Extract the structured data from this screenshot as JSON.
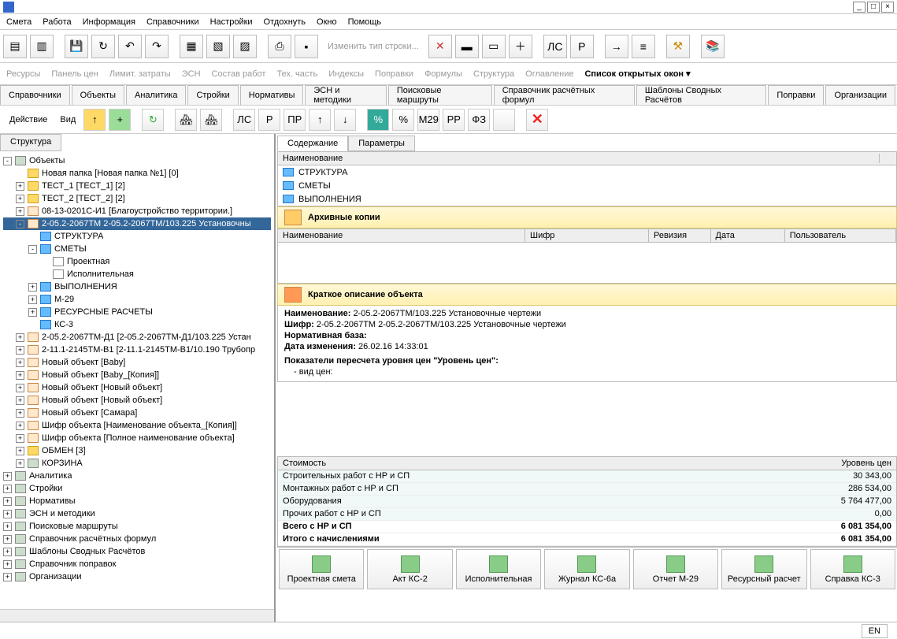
{
  "menubar": [
    "Смета",
    "Работа",
    "Информация",
    "Справочники",
    "Настройки",
    "Отдохнуть",
    "Окно",
    "Помощь"
  ],
  "toolbar1_text": "Изменить тип строки...",
  "toolbar1_badges": [
    "ЛС",
    "Р"
  ],
  "toolbar2": {
    "items": [
      "Ресурсы",
      "Панель цен",
      "Лимит. затраты",
      "ЭСН",
      "Состав работ",
      "Тех. часть",
      "Индексы",
      "Поправки",
      "Формулы",
      "Структура",
      "Оглавление"
    ],
    "active": "Список открытых окон ▾"
  },
  "toolbar3": [
    "Справочники",
    "Объекты",
    "Аналитика",
    "Стройки",
    "Нормативы",
    "ЭСН и методики",
    "Поисковые маршруты",
    "Справочник расчётных формул",
    "Шаблоны Сводных Расчётов",
    "Поправки",
    "Организации"
  ],
  "toolbar4": {
    "action": "Действие",
    "view": "Вид",
    "badges": [
      "ЛС",
      "Р",
      "ПР",
      "%",
      "%",
      "М29",
      "РР",
      "ФЗ"
    ]
  },
  "left_tab": "Структура",
  "tree": [
    {
      "d": 0,
      "e": "-",
      "i": "gen",
      "t": "Объекты"
    },
    {
      "d": 1,
      "e": " ",
      "i": "folder",
      "t": "Новая папка [Новая папка №1]  [0]"
    },
    {
      "d": 1,
      "e": "+",
      "i": "folder",
      "t": "ТЕСТ_1 [ТЕСТ_1]  [2]"
    },
    {
      "d": 1,
      "e": "+",
      "i": "folder",
      "t": "ТЕСТ_2 [ТЕСТ_2]  [2]"
    },
    {
      "d": 1,
      "e": "+",
      "i": "house",
      "t": "08-13-0201С-И1 [Благоустройство территории.]"
    },
    {
      "d": 1,
      "e": "-",
      "i": "house",
      "t": "2-05.2-2067ТМ 2-05.2-2067ТМ/103.225 Установочны",
      "sel": true
    },
    {
      "d": 2,
      "e": " ",
      "i": "bfolder",
      "t": "СТРУКТУРА"
    },
    {
      "d": 2,
      "e": "-",
      "i": "bfolder",
      "t": "СМЕТЫ"
    },
    {
      "d": 3,
      "e": " ",
      "i": "doc",
      "t": "Проектная"
    },
    {
      "d": 3,
      "e": " ",
      "i": "doc",
      "t": "Исполнительная"
    },
    {
      "d": 2,
      "e": "+",
      "i": "bfolder",
      "t": "ВЫПОЛНЕНИЯ"
    },
    {
      "d": 2,
      "e": "+",
      "i": "bfolder",
      "t": "М-29"
    },
    {
      "d": 2,
      "e": "+",
      "i": "bfolder",
      "t": "РЕСУРСНЫЕ РАСЧЕТЫ"
    },
    {
      "d": 2,
      "e": " ",
      "i": "bfolder",
      "t": "КС-3"
    },
    {
      "d": 1,
      "e": "+",
      "i": "house",
      "t": "2-05.2-2067ТМ-Д1 [2-05.2-2067ТМ-Д1/103.225 Устан"
    },
    {
      "d": 1,
      "e": "+",
      "i": "house",
      "t": "2-11.1-2145ТМ-В1 [2-11.1-2145ТМ-В1/10.190 Трубопр"
    },
    {
      "d": 1,
      "e": "+",
      "i": "house",
      "t": "Новый объект [Baby]"
    },
    {
      "d": 1,
      "e": "+",
      "i": "house",
      "t": "Новый объект [Baby_[Копия]]"
    },
    {
      "d": 1,
      "e": "+",
      "i": "house",
      "t": "Новый объект [Новый объект]"
    },
    {
      "d": 1,
      "e": "+",
      "i": "house",
      "t": "Новый объект [Новый объект]"
    },
    {
      "d": 1,
      "e": "+",
      "i": "house",
      "t": "Новый объект [Самара]"
    },
    {
      "d": 1,
      "e": "+",
      "i": "house",
      "t": "Шифр объекта [Наименование объекта_[Копия]]"
    },
    {
      "d": 1,
      "e": "+",
      "i": "house",
      "t": "Шифр объекта [Полное наименование объекта]"
    },
    {
      "d": 1,
      "e": "+",
      "i": "folder",
      "t": "ОБМЕН  [3]"
    },
    {
      "d": 1,
      "e": "+",
      "i": "gen",
      "t": "КОРЗИНА"
    },
    {
      "d": 0,
      "e": "+",
      "i": "gen",
      "t": "Аналитика"
    },
    {
      "d": 0,
      "e": "+",
      "i": "gen",
      "t": "Стройки"
    },
    {
      "d": 0,
      "e": "+",
      "i": "gen",
      "t": "Нормативы"
    },
    {
      "d": 0,
      "e": "+",
      "i": "gen",
      "t": "ЭСН и методики"
    },
    {
      "d": 0,
      "e": "+",
      "i": "gen",
      "t": "Поисковые маршруты"
    },
    {
      "d": 0,
      "e": "+",
      "i": "gen",
      "t": "Справочник расчётных формул"
    },
    {
      "d": 0,
      "e": "+",
      "i": "gen",
      "t": "Шаблоны Сводных Расчётов"
    },
    {
      "d": 0,
      "e": "+",
      "i": "gen",
      "t": "Справочник поправок"
    },
    {
      "d": 0,
      "e": "+",
      "i": "gen",
      "t": "Организации"
    }
  ],
  "right_tabs": [
    "Содержание",
    "Параметры"
  ],
  "content_header": "Наименование",
  "content_rows": [
    "СТРУКТУРА",
    "СМЕТЫ",
    "ВЫПОЛНЕНИЯ"
  ],
  "archive": {
    "banner": "Архивные копии",
    "cols": [
      "Наименование",
      "Шифр",
      "Ревизия",
      "Дата",
      "Пользователь"
    ]
  },
  "desc": {
    "banner": "Краткое описание объекта",
    "name_lbl": "Наименование:",
    "name_val": "2-05.2-2067ТМ/103.225 Установочные чертежи",
    "code_lbl": "Шифр:",
    "code_val": "2-05.2-2067ТМ 2-05.2-2067ТМ/103.225 Установочные чертежи",
    "base_lbl": "Нормативная база:",
    "base_val": "",
    "date_lbl": "Дата изменения:",
    "date_val": "26.02.16 14:33:01",
    "recalc": "Показатели пересчета уровня цен \"Уровень цен\":",
    "recalc_sub": "- вид цен:"
  },
  "cost": {
    "header_l": "Стоимость",
    "header_r": "Уровень цен",
    "rows": [
      {
        "l": "Строительных работ с НР и СП",
        "r": "30 343,00"
      },
      {
        "l": "Монтажных работ с НР и СП",
        "r": "286 534,00"
      },
      {
        "l": "Оборудования",
        "r": "5 764 477,00"
      },
      {
        "l": "Прочих работ с НР и СП",
        "r": "0,00"
      }
    ],
    "totals": [
      {
        "l": "Всего с НР и СП",
        "r": "6 081 354,00"
      },
      {
        "l": "Итого с начислениями",
        "r": "6 081 354,00"
      }
    ]
  },
  "doc_buttons": [
    "Проектная смета",
    "Акт КС-2",
    "Исполнительная",
    "Журнал КС-6а",
    "Отчет М-29",
    "Ресурсный расчет",
    "Справка КС-3"
  ],
  "status_lang": "EN"
}
